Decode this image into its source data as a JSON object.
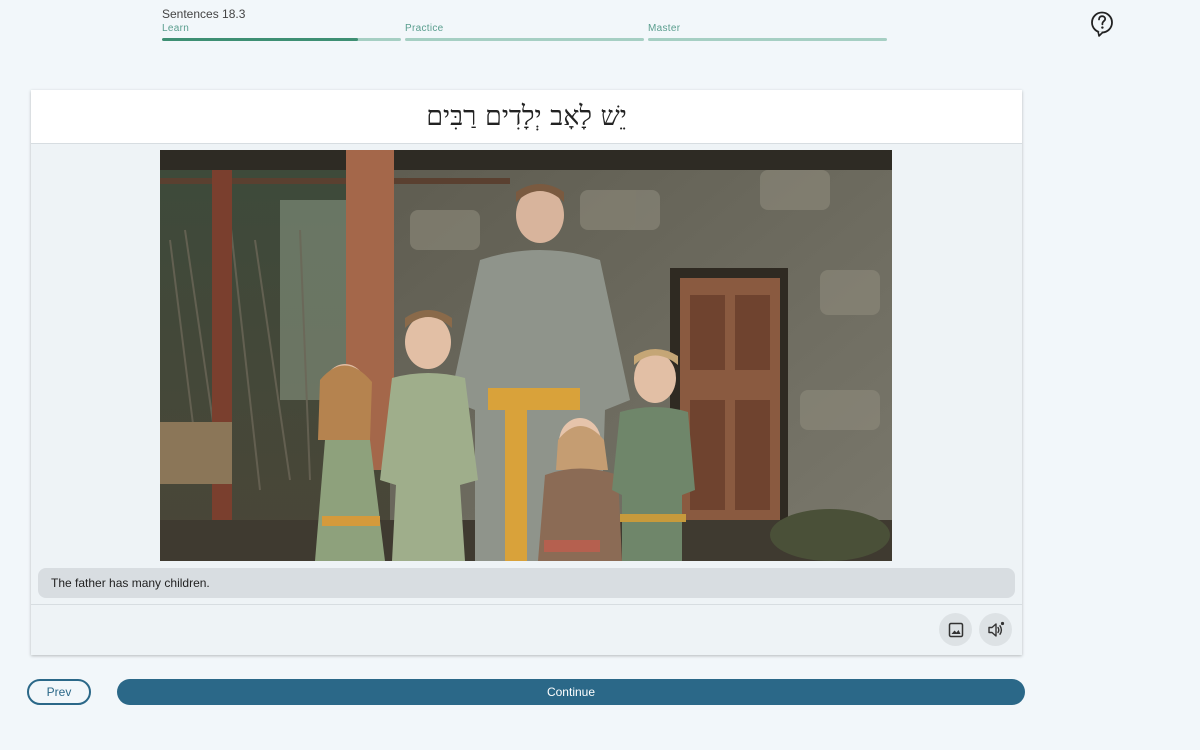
{
  "lesson": {
    "title": "Sentences 18.3"
  },
  "stages": [
    {
      "label": "Learn",
      "progress": 0.82
    },
    {
      "label": "Practice",
      "progress": 0
    },
    {
      "label": "Master",
      "progress": 0
    }
  ],
  "card": {
    "hebrew_sentence": "יֵשׁ לָאָב יְלָדִים רַבִּים",
    "translation": "The father has many children."
  },
  "icons": {
    "help": "help-bubble-icon",
    "image": "image-icon",
    "audio": "speaker-icon"
  },
  "buttons": {
    "prev": "Prev",
    "continue": "Continue"
  },
  "colors": {
    "accent": "#2b6888",
    "progress_fill": "#3e8f73",
    "progress_track": "#a6cfc3",
    "background": "#f2f7fa"
  }
}
